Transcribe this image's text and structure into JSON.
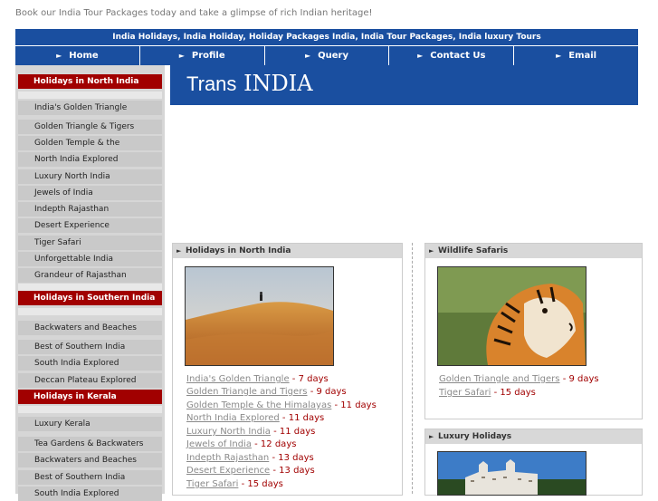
{
  "tagline": "Book our India Tour Packages today and take a glimpse of rich Indian heritage!",
  "banner_links": "India Holidays, India Holiday, Holiday Packages India, India Tour Packages, India luxury Tours",
  "nav": [
    "Home",
    "Profile",
    "Query",
    "Contact Us",
    "Email"
  ],
  "logo": {
    "prefix": "Trans",
    "main": "INDIA"
  },
  "sidebar": {
    "north_head": "Holidays in North India",
    "north_items": [
      "India's Golden Triangle",
      "Golden Triangle & Tigers",
      "Golden Temple & the Himalayas",
      "North India Explored",
      "Luxury North India",
      "Jewels of India",
      "Indepth Rajasthan",
      "Desert Experience",
      "Tiger Safari",
      "Unforgettable India",
      "Grandeur of Rajasthan"
    ],
    "south_head": "Holidays in Southern India",
    "south_items": [
      "Backwaters and Beaches",
      "Best of Southern India",
      "South India Explored",
      "Deccan Plateau Explored"
    ],
    "kerala_head": "Holidays in Kerala",
    "kerala_items": [
      "Luxury Kerala",
      "Tea Gardens & Backwaters",
      "Backwaters and Beaches",
      "Best of Southern India",
      "South India Explored"
    ]
  },
  "north_panel": {
    "title": "Holidays in North India",
    "tours": [
      {
        "name": "India's Golden Triangle",
        "days": " - 7 days"
      },
      {
        "name": "Golden Triangle and Tigers",
        "days": " - 9 days"
      },
      {
        "name": "Golden Temple & the Himalayas",
        "days": " - 11 days"
      },
      {
        "name": "North India Explored",
        "days": " - 11 days"
      },
      {
        "name": "Luxury North India",
        "days": " - 11 days"
      },
      {
        "name": "Jewels of India",
        "days": " - 12 days"
      },
      {
        "name": "Indepth Rajasthan",
        "days": " - 13 days"
      },
      {
        "name": "Desert Experience",
        "days": " - 13 days"
      },
      {
        "name": "Tiger Safari",
        "days": " - 15 days"
      }
    ]
  },
  "wildlife_panel": {
    "title": "Wildlife Safaris",
    "tours": [
      {
        "name": "Golden Triangle and Tigers",
        "days": " - 9 days"
      },
      {
        "name": "Tiger Safari",
        "days": " - 15 days"
      }
    ]
  },
  "luxury_panel": {
    "title": "Luxury Holidays"
  },
  "colors": {
    "blue": "#1a4fa0",
    "red": "#a10000"
  }
}
